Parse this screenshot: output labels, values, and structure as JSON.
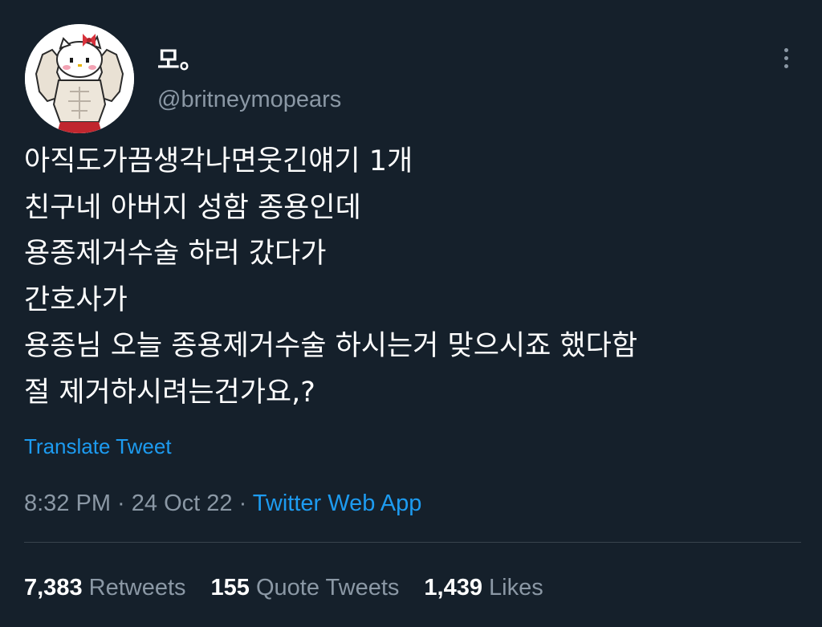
{
  "user": {
    "display_name": "모。",
    "handle": "@britneymopears"
  },
  "tweet": {
    "lines": [
      "아직도가끔생각나면웃긴얘기 1개",
      "친구네 아버지 성함 종용인데",
      "용종제거수술 하러 갔다가",
      "간호사가",
      "용종님 오늘 종용제거수술 하시는거 맞으시죠 했다함",
      "절 제거하시려는건가요,?"
    ],
    "translate_label": "Translate Tweet",
    "time": "8:32 PM",
    "date": "24 Oct 22",
    "separator": " · ",
    "source": "Twitter Web App"
  },
  "stats": {
    "retweets_count": "7,383",
    "retweets_label": "Retweets",
    "quotes_count": "155",
    "quotes_label": "Quote Tweets",
    "likes_count": "1,439",
    "likes_label": "Likes"
  },
  "icons": {
    "more": "more-vertical-icon"
  },
  "colors": {
    "background": "#15202b",
    "text_primary": "#ffffff",
    "text_secondary": "#8b98a5",
    "accent": "#1d9bf0",
    "divider": "#38444d"
  }
}
